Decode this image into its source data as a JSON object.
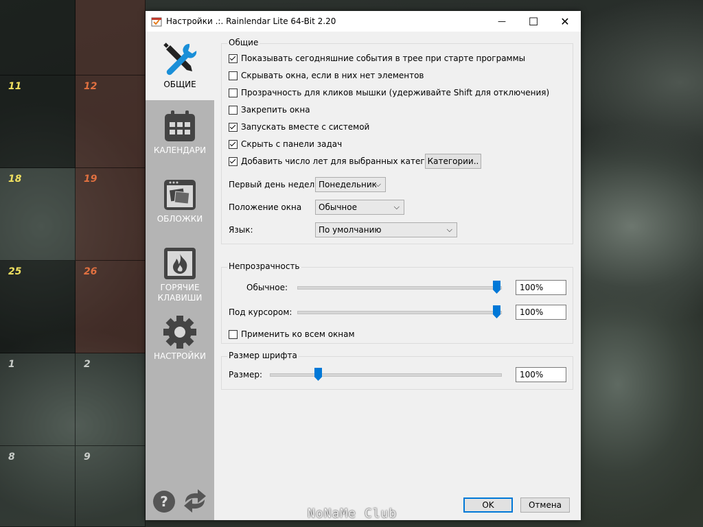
{
  "window": {
    "title": "Настройки .:. Rainlendar Lite 64-Bit 2.20",
    "controls": {
      "minimize": "—",
      "maximize": "☐",
      "close": "✕"
    }
  },
  "calendar": {
    "days": [
      "11",
      "12",
      "18",
      "19",
      "25",
      "26",
      "1",
      "2",
      "8",
      "9"
    ]
  },
  "sidebar": {
    "items": [
      {
        "label": "ОБЩИЕ",
        "icon": "tools-icon",
        "active": true
      },
      {
        "label": "КАЛЕНДАРИ",
        "icon": "calendar-icon",
        "active": false
      },
      {
        "label": "ОБЛОЖКИ",
        "icon": "skins-icon",
        "active": false
      },
      {
        "label": "ГОРЯЧИЕ КЛАВИШИ",
        "icon": "hotkeys-flame-icon",
        "active": false
      },
      {
        "label": "НАСТРОЙКИ",
        "icon": "gear-icon",
        "active": false
      }
    ],
    "bottom_icons": [
      "help-icon",
      "refresh-icon"
    ]
  },
  "general": {
    "title": "Общие",
    "checkboxes": [
      {
        "label": "Показывать сегодняшние события в трее при старте программы",
        "checked": true
      },
      {
        "label": "Скрывать окна, если в них нет элементов",
        "checked": false
      },
      {
        "label": "Прозрачность для кликов мышки (удерживайте Shift для отключения)",
        "checked": false
      },
      {
        "label": "Закрепить окна",
        "checked": false
      },
      {
        "label": "Запускать вместе с системой",
        "checked": true
      },
      {
        "label": "Скрыть с панели задач",
        "checked": true
      },
      {
        "label": "Добавить число лет для выбранных категорий",
        "checked": true
      }
    ],
    "categories_button": "Категории..",
    "first_day_label": "Первый день недели:",
    "first_day_value": "Понедельник",
    "window_position_label": "Положение окна",
    "window_position_value": "Обычное",
    "language_label": "Язык:",
    "language_value": "По умолчанию"
  },
  "opacity": {
    "title": "Непрозрачность",
    "normal_label": "Обычное:",
    "normal_value": "100%",
    "normal_level": 1.0,
    "hover_label": "Под курсором:",
    "hover_value": "100%",
    "hover_level": 1.0,
    "apply_all_label": "Применить ко всем окнам",
    "apply_all_checked": false
  },
  "font_size": {
    "title": "Размер шрифта",
    "size_label": "Размер:",
    "size_value": "100%",
    "size_level": 0.2
  },
  "buttons": {
    "ok": "OK",
    "cancel": "Отмена"
  },
  "watermark": "NoNaMe Club",
  "colors": {
    "accent": "#0078d7",
    "sidebar": "#b4b4b4",
    "tools_blue": "#1a8fd8"
  }
}
